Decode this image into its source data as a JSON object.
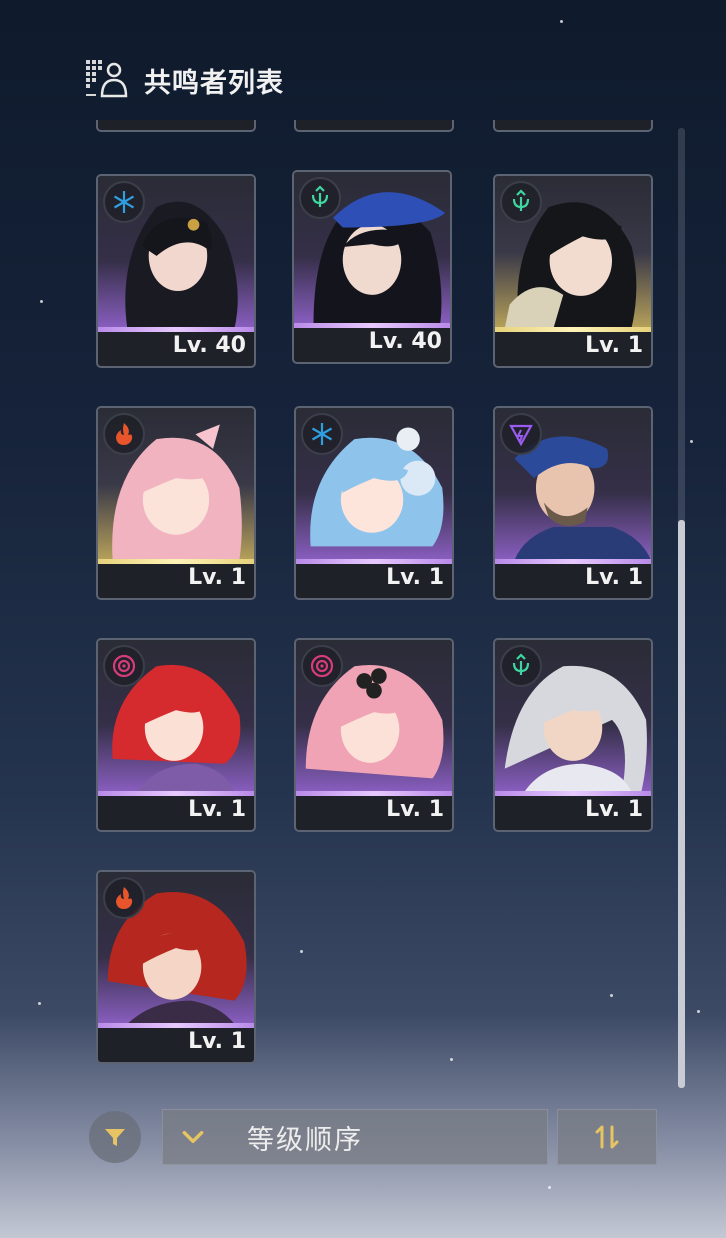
{
  "header": {
    "title": "共鸣者列表",
    "icon": "resonator-list-icon"
  },
  "colors": {
    "accent_gold": "#e6c463",
    "rarity_5": "#e6d27a",
    "rarity_4": "#b98ae8",
    "glacio": "#2f9fe0",
    "aero": "#3fd6a0",
    "fusion": "#e8552a",
    "electro": "#9a5cf0",
    "havoc": "#d63c7a"
  },
  "resonators": [
    {
      "level": "Lv. 40",
      "element": "glacio-icon",
      "rarity": 4
    },
    {
      "level": "Lv. 40",
      "element": "aero-icon",
      "rarity": 4
    },
    {
      "level": "Lv. 1",
      "element": "aero-icon",
      "rarity": 5
    },
    {
      "level": "Lv. 1",
      "element": "fusion-icon",
      "rarity": 5
    },
    {
      "level": "Lv. 1",
      "element": "glacio-icon",
      "rarity": 4
    },
    {
      "level": "Lv. 1",
      "element": "electro-icon",
      "rarity": 4
    },
    {
      "level": "Lv. 1",
      "element": "havoc-icon",
      "rarity": 4
    },
    {
      "level": "Lv. 1",
      "element": "havoc-icon",
      "rarity": 4
    },
    {
      "level": "Lv. 1",
      "element": "aero-icon",
      "rarity": 4
    },
    {
      "level": "Lv. 1",
      "element": "fusion-icon",
      "rarity": 4
    }
  ],
  "footer": {
    "filter_icon": "filter-icon",
    "sort_label": "等级顺序",
    "sort_chevron": "chevron-down-icon",
    "order_icon": "sort-order-icon"
  }
}
